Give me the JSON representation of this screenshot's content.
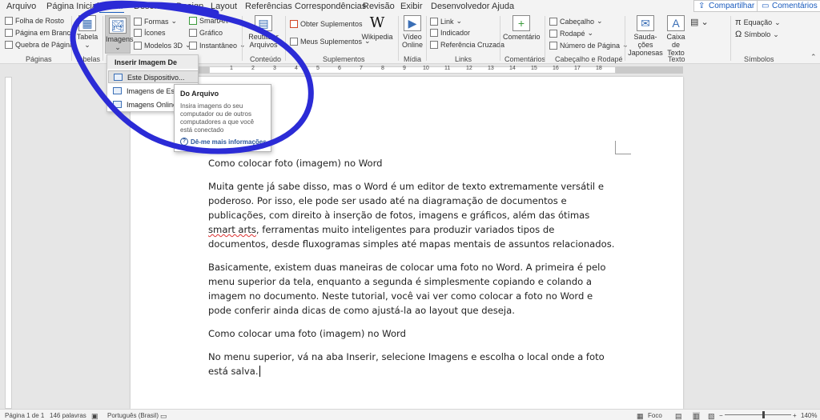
{
  "tabs": [
    "Arquivo",
    "Página Inicial",
    "Inserir",
    "Desenhar",
    "Design",
    "Layout",
    "Referências",
    "Correspondências",
    "Revisão",
    "Exibir",
    "Desenvolvedor",
    "Ajuda"
  ],
  "active_tab": "Inserir",
  "top_buttons": {
    "share": "Compartilhar",
    "comments": "Comentários"
  },
  "ribbon": {
    "pages": {
      "items": [
        "Folha de Rosto",
        "Página em Branco",
        "Quebra de Página"
      ],
      "label": "Páginas"
    },
    "tables": {
      "button": "Tabela",
      "label": "Tabelas"
    },
    "illustrations": {
      "images_button": "Imagens",
      "items": [
        "Formas",
        "Ícones",
        "Modelos 3D"
      ],
      "items2": [
        "SmartArt",
        "Gráfico",
        "Instantâneo"
      ]
    },
    "content": {
      "button": "Reutilizar Arquivos",
      "label": "Conteúdo"
    },
    "addins": {
      "items": [
        "Obter Suplementos",
        "Meus Suplementos"
      ],
      "wikipedia": "Wikipedia",
      "label": "Suplementos"
    },
    "media": {
      "button": "Vídeo Online",
      "label": "Mídia"
    },
    "links": {
      "items": [
        "Link",
        "Indicador",
        "Referência Cruzada"
      ],
      "label": "Links"
    },
    "comments": {
      "button": "Comentário",
      "label": "Comentários"
    },
    "header_footer": {
      "items": [
        "Cabeçalho",
        "Rodapé",
        "Número de Página"
      ],
      "label": "Cabeçalho e Rodapé"
    },
    "text": {
      "items": [
        "Sauda­ções Japonesas",
        "Caixa de Texto"
      ],
      "label": "Texto"
    },
    "symbols": {
      "items": [
        "Equação",
        "Símbolo"
      ],
      "label": "Símbolos"
    }
  },
  "ruler_numbers": [
    "1",
    "2",
    "1",
    "2",
    "3",
    "4",
    "5",
    "6",
    "7",
    "8",
    "9",
    "10",
    "11",
    "12",
    "13",
    "14",
    "15",
    "16",
    "17",
    "18"
  ],
  "dropdown": {
    "header": "Inserir Imagem De",
    "items": [
      "Este Dispositivo...",
      "Imagens de Estoque...",
      "Imagens Online..."
    ]
  },
  "tooltip": {
    "title": "Do Arquivo",
    "body": "Insira imagens do seu computador ou de outros computadores a que você está conectado",
    "link": "Dê-me mais informações"
  },
  "document": {
    "heading1": "Como colocar foto (imagem) no Word",
    "p1_a": "Muita gente já sabe disso, mas o Word é um editor de texto extremamente versátil e poderoso. Por isso, ele pode ser usado até na diagramação de documentos e publicações, com direito à inserção de fotos, imagens e gráficos, além das ótimas ",
    "p1_squiggle": "smart arts",
    "p1_b": ", ferramentas muito inteligentes para produzir variados tipos de documentos, desde fluxogramas simples até mapas mentais de assuntos relacionados.",
    "p2": "Basicamente, existem duas maneiras de colocar uma foto no Word. A primeira é pelo menu superior da tela, enquanto a segunda é simplesmente copiando e colando a imagem no documento. Neste tutorial, você vai ver como colocar a foto no Word e pode conferir ainda dicas de como ajustá-la ao layout que deseja.",
    "heading2": "Como colocar uma foto (imagem) no Word",
    "p3": "No menu superior, vá na aba Inserir, selecione Imagens e escolha o local onde a foto está salva."
  },
  "statusbar": {
    "page": "Página 1 de 1",
    "words": "146 palavras",
    "language": "Português (Brasil)",
    "focus": "Foco",
    "zoom": "140%"
  },
  "colors": {
    "accent": "#185abd",
    "annotation": "#2b2bd6"
  }
}
